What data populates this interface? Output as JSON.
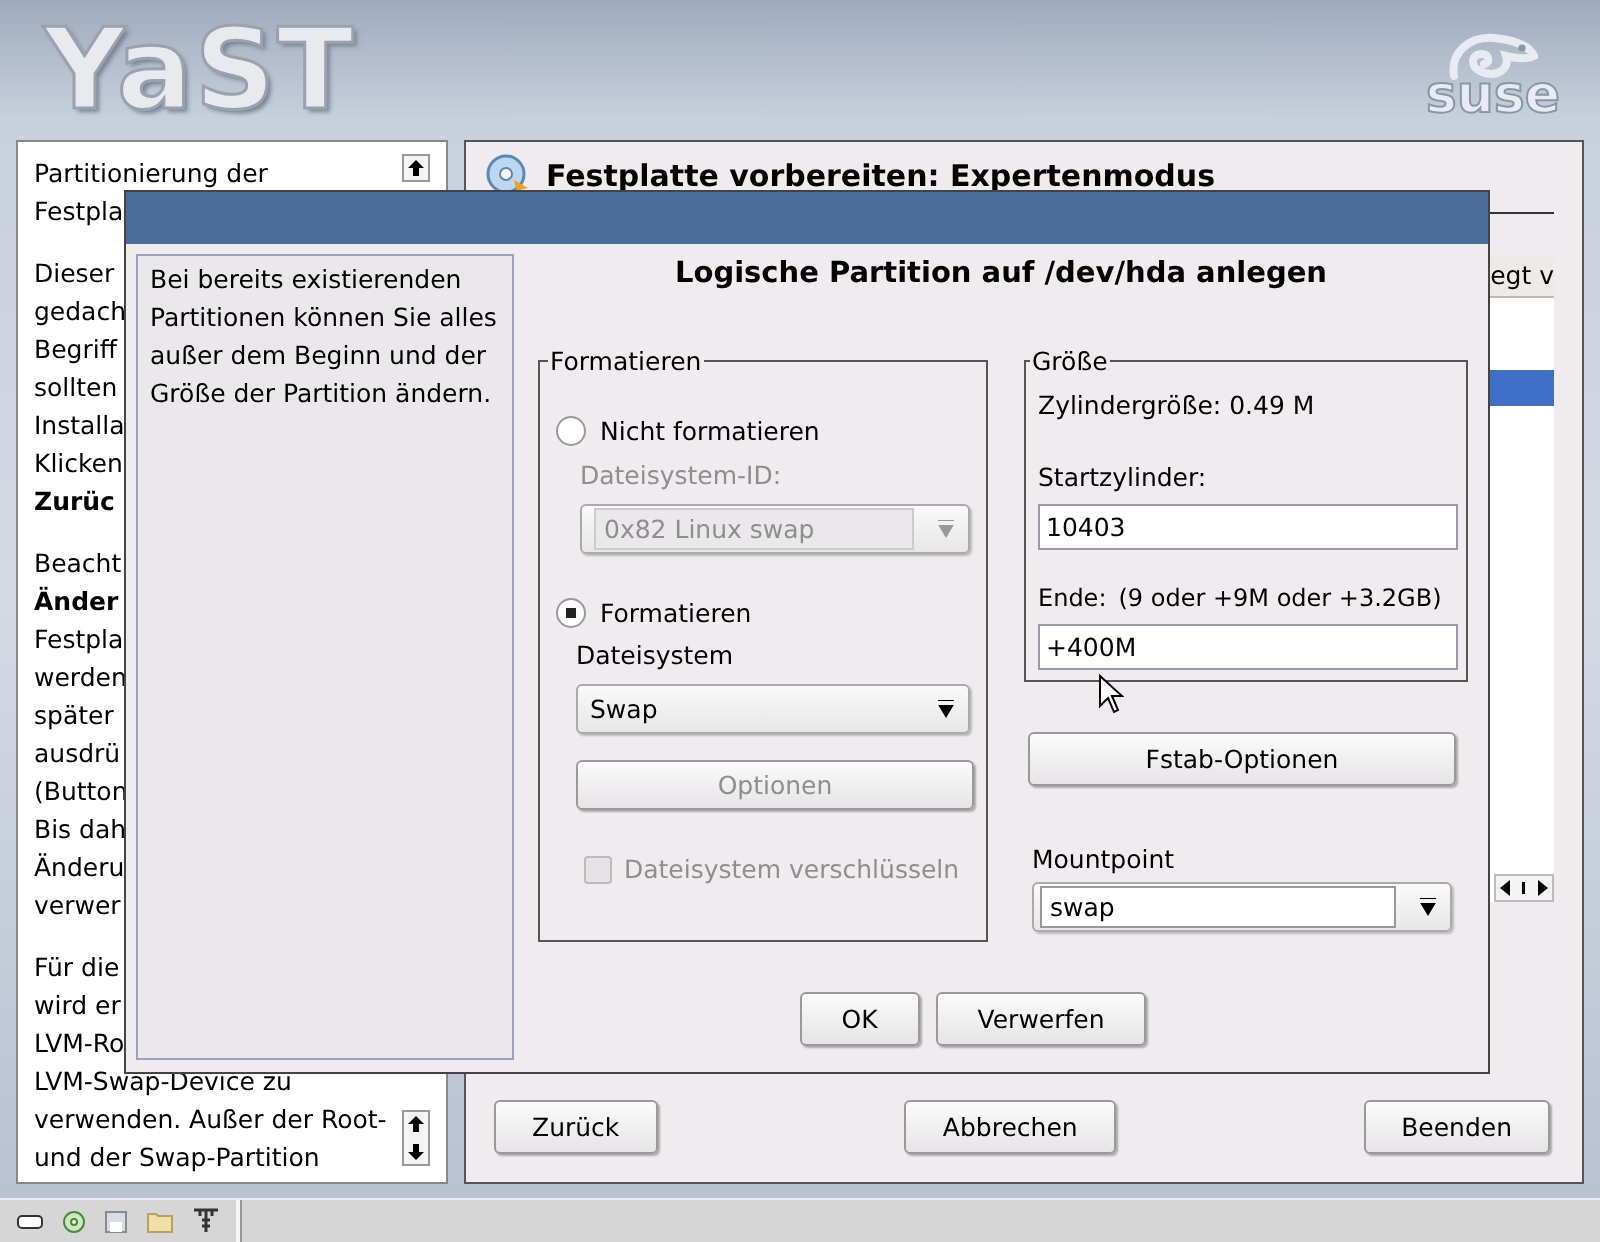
{
  "header": {
    "logo": "YaST",
    "brand": "suse"
  },
  "help": {
    "paragraphs": [
      {
        "lines": [
          {
            "text": "Partitionierung der",
            "bold": false
          },
          {
            "text": "Festpla",
            "bold": false
          }
        ]
      },
      {
        "lines": [
          {
            "text": "Dieser",
            "bold": false
          },
          {
            "text": "gedach",
            "bold": false
          },
          {
            "text": "Begriff",
            "bold": false
          },
          {
            "text": "sollten",
            "bold": false
          },
          {
            "text": "Installa",
            "bold": false
          },
          {
            "text": "Klicken",
            "bold": false
          },
          {
            "text": "Zurüc",
            "bold": true
          }
        ]
      },
      {
        "lines": [
          {
            "text": "Beacht",
            "bold": false
          },
          {
            "text": "Änder",
            "bold": true
          },
          {
            "text": "Festpla",
            "bold": false
          },
          {
            "text": "werden",
            "bold": false
          },
          {
            "text": "später",
            "bold": false
          },
          {
            "text": "ausdrü",
            "bold": false
          },
          {
            "text": "(Button",
            "bold": false
          },
          {
            "text": "Bis dah",
            "bold": false
          },
          {
            "text": "Änderu",
            "bold": false
          },
          {
            "text": "verwer",
            "bold": false
          }
        ]
      },
      {
        "lines": [
          {
            "text": "Für die",
            "bold": false
          },
          {
            "text": "wird er",
            "bold": false
          },
          {
            "text": "LVM-Ro",
            "bold": false
          },
          {
            "text": "LVM-Swap-Device zu",
            "bold": false
          },
          {
            "text": "verwenden. Außer der Root-",
            "bold": false
          },
          {
            "text": "und der Swap-Partition",
            "bold": false
          }
        ]
      }
    ]
  },
  "main": {
    "title": "Festplatte vorbereiten: Expertenmodus",
    "table": {
      "column_1": "egt v",
      "rows": [
        {
          "selected": false
        },
        {
          "selected": false
        },
        {
          "selected": true
        }
      ]
    },
    "buttons": [
      {
        "label": "Zurück"
      },
      {
        "label": "Abbrechen"
      },
      {
        "label": "Beenden"
      }
    ]
  },
  "dialog": {
    "heading": "Logische Partition auf /dev/hda anlegen",
    "help": "Bei bereits existierenden Partitionen können Sie alles außer dem Beginn und der Größe der Partition ändern.",
    "format": {
      "title": "Formatieren",
      "options": [
        {
          "label": "Nicht formatieren",
          "selected": false
        },
        {
          "label": "Formatieren",
          "selected": true
        }
      ],
      "fs_id": {
        "label": "Dateisystem-ID:",
        "value": "0x82 Linux swap",
        "disabled": true
      },
      "filesystem": {
        "label": "Dateisystem",
        "value": "Swap",
        "disabled": false
      },
      "options_button": {
        "label": "Optionen",
        "disabled": true
      },
      "encrypt": {
        "label": "Dateisystem verschlüsseln",
        "checked": false,
        "disabled": true
      }
    },
    "size": {
      "title": "Größe",
      "cylinder_size": "Zylindergröße: 0.49 M",
      "start": {
        "label": "Startzylinder:",
        "value": "10403"
      },
      "end": {
        "label": "Ende:",
        "hint": "(9 oder +9M oder +3.2GB)",
        "value": "+400M"
      }
    },
    "fstab_button": "Fstab-Optionen",
    "mountpoint": {
      "label": "Mountpoint",
      "value": "swap"
    },
    "buttons": [
      {
        "label": "OK"
      },
      {
        "label": "Verwerfen"
      }
    ]
  }
}
